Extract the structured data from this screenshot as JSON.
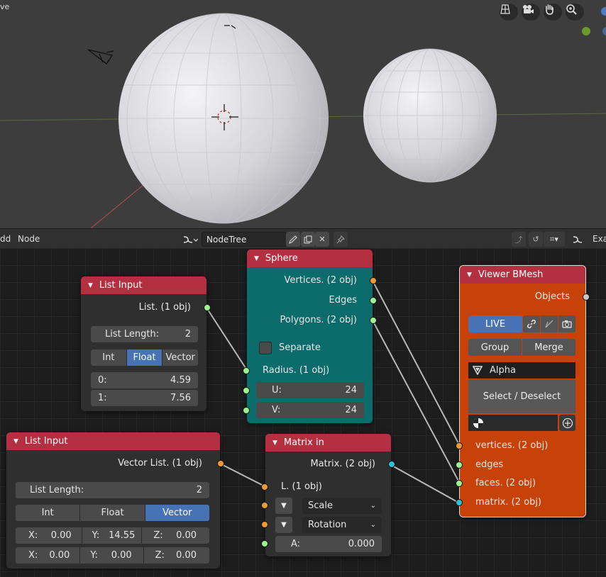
{
  "viewport": {
    "title": "ve"
  },
  "header": {
    "menu_add": "dd",
    "menu_node": "Node",
    "tree_name": "NodeTree",
    "right_label": "Exa"
  },
  "nodes": {
    "list_input_1": {
      "title": "List Input",
      "output": "List. (1 obj)",
      "list_length_label": "List Length:",
      "list_length_value": "2",
      "modes": [
        "Int",
        "Float",
        "Vector"
      ],
      "active_mode": "Float",
      "rows": [
        {
          "label": "0:",
          "value": "4.59"
        },
        {
          "label": "1:",
          "value": "7.56"
        }
      ]
    },
    "sphere": {
      "title": "Sphere",
      "outputs": [
        "Vertices. (2 obj)",
        "Edges",
        "Polygons. (2 obj)"
      ],
      "separate_label": "Separate",
      "radius_label": "Radius. (1 obj)",
      "u_label": "U:",
      "u_value": "24",
      "v_label": "V:",
      "v_value": "24"
    },
    "viewer": {
      "title": "Viewer BMesh",
      "output": "Objects",
      "live_label": "LIVE",
      "group_label": "Group",
      "merge_label": "Merge",
      "name": "Alpha",
      "select_label": "Select / Deselect",
      "inputs": [
        "vertices. (2 obj)",
        "edges",
        "faces. (2 obj)",
        "matrix. (2 obj)"
      ]
    },
    "list_input_2": {
      "title": "List Input",
      "output": "Vector List. (1 obj)",
      "list_length_label": "List Length:",
      "list_length_value": "2",
      "modes": [
        "Int",
        "Float",
        "Vector"
      ],
      "active_mode": "Vector",
      "vectors": [
        {
          "x": "0.00",
          "y": "14.55",
          "z": "0.00"
        },
        {
          "x": "0.00",
          "y": "0.00",
          "z": "0.00"
        }
      ],
      "axis_labels": {
        "x": "X:",
        "y": "Y:",
        "z": "Z:"
      }
    },
    "matrix_in": {
      "title": "Matrix in",
      "output": "Matrix. (2 obj)",
      "location_label": "L. (1 obj)",
      "scale_label": "Scale",
      "rotation_label": "Rotation",
      "angle_label": "A:",
      "angle_value": "0.000"
    }
  },
  "colors": {
    "node_header": "#b43040",
    "sphere_body": "#0c6b6b",
    "viewer_body": "#c74209",
    "active_toggle": "#4772b3"
  }
}
